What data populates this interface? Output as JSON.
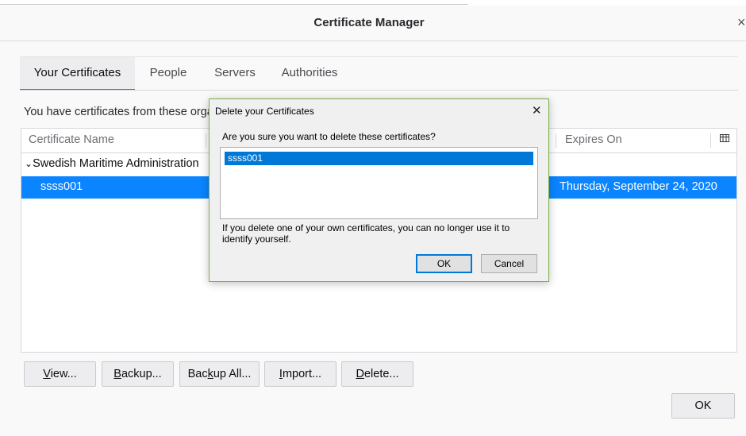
{
  "window": {
    "title": "Certificate Manager",
    "close_glyph": "×"
  },
  "tabs": [
    {
      "label": "Your Certificates",
      "active": true
    },
    {
      "label": "People",
      "active": false
    },
    {
      "label": "Servers",
      "active": false
    },
    {
      "label": "Authorities",
      "active": false
    }
  ],
  "intro_text": "You have certificates from these orga",
  "table": {
    "columns": [
      "Certificate Name",
      "Expires On"
    ],
    "column_picker_icon": "column-picker-icon",
    "group": {
      "toggle": "⌄",
      "label": "Swedish Maritime Administration"
    },
    "row": {
      "name": "ssss001",
      "expires": "Thursday, September 24, 2020"
    }
  },
  "buttons": {
    "view": {
      "pre": "",
      "key": "V",
      "post": "iew..."
    },
    "backup": {
      "pre": "",
      "key": "B",
      "post": "ackup..."
    },
    "backup_all": {
      "pre": "Bac",
      "key": "k",
      "post": "up All..."
    },
    "import": {
      "pre": "",
      "key": "I",
      "post": "mport..."
    },
    "delete": {
      "pre": "",
      "key": "D",
      "post": "elete..."
    },
    "ok": "OK"
  },
  "dialog": {
    "title": "Delete your Certificates",
    "close_glyph": "✕",
    "question": "Are you sure you want to delete these certificates?",
    "items": [
      "ssss001"
    ],
    "warning": "If you delete one of your own certificates, you can no longer use it to identify yourself.",
    "ok_label": "OK",
    "cancel_label": "Cancel"
  },
  "colors": {
    "accent": "#0a84ff",
    "dialog_border": "#7ab04a",
    "dialog_selection": "#0078d7"
  }
}
